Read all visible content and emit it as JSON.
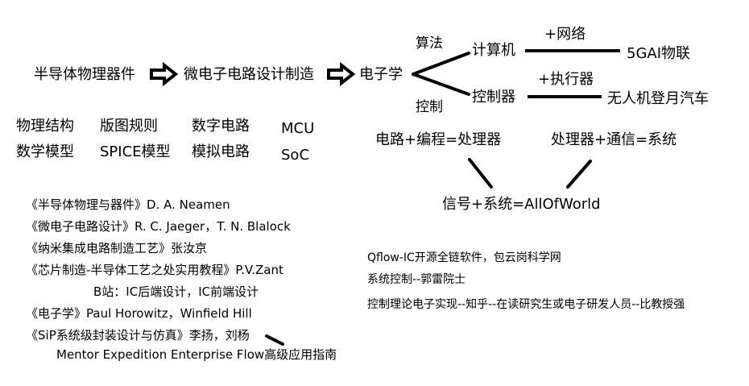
{
  "flow": {
    "n1": "半导体物理器件",
    "n2": "微电子电路设计制造",
    "n3": "电子学",
    "upper_edge": "算法",
    "lower_edge": "控制",
    "computer": "计算机",
    "controller": "控制器",
    "network": "+网络",
    "actuator": "+执行器",
    "iot": "5GAI物联",
    "uav": "无人机登月汽车"
  },
  "grid": {
    "c1r1": "物理结构",
    "c1r2": "数学模型",
    "c2r1": "版图规则",
    "c2r2": "SPICE模型",
    "c3r1": "数字电路",
    "c3r2": "模拟电路",
    "c4r1": "MCU",
    "c4r2": "SoC"
  },
  "equations": {
    "e1": "电路+编程=处理器",
    "e2": "处理器+通信=系统",
    "e3": "信号+系统=AllOfWorld"
  },
  "books": [
    "《半导体物理与器件》D. A. Neamen",
    "《微电子电路设计》R. C. Jaeger，T. N. Blalock",
    "《纳米集成电路制造工艺》张汝京",
    "《芯片制造-半导体工艺之处实用教程》P.V.Zant",
    "B站：IC后端设计，IC前端设计",
    "《电子学》Paul Horowitz，Winfield Hill",
    "《SiP系统级封装设计与仿真》李扬，刘杨",
    "Mentor Expedition Enterprise Flow高级应用指南"
  ],
  "notes": [
    "Qflow-IC开源全链软件，包云岗科学网",
    "系统控制--郭雷院士",
    "控制理论电子实现--知乎--在读研究生或电子研发人员--比教授强"
  ]
}
